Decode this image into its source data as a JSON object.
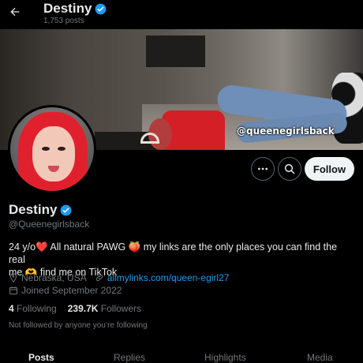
{
  "header": {
    "title": "Destiny",
    "post_count": "1,753 posts"
  },
  "banner": {
    "watermark": "@queenegirlsback"
  },
  "actions": {
    "follow_label": "Follow"
  },
  "profile": {
    "name": "Destiny",
    "handle": "@Queenegirlsback",
    "bio_line1": "24 y/o❤️    All natural PAWG 🍑 my links are the only places you can find the real",
    "bio_line2": "me 🫶 find me on TikTok",
    "location": "Nebraska, USA",
    "link": "allmylinks.com/queen-egirl27",
    "joined": "Joined September 2022",
    "following_count": "4",
    "following_label": "Following",
    "followers_count": "239.7K",
    "followers_label": "Followers",
    "not_followed": "Not followed by anyone you’re following"
  },
  "tabs": [
    {
      "label": "Posts",
      "active": true
    },
    {
      "label": "Replies",
      "active": false
    },
    {
      "label": "Highlights",
      "active": false
    },
    {
      "label": "Media",
      "active": false
    }
  ],
  "colors": {
    "background": "#000000",
    "accent": "#1d9bf0",
    "muted": "#71767b",
    "verified": "#1d9bf0"
  },
  "icons": [
    "back-arrow-icon",
    "verified-badge-icon",
    "more-icon",
    "search-icon",
    "location-icon",
    "link-icon",
    "calendar-icon"
  ]
}
